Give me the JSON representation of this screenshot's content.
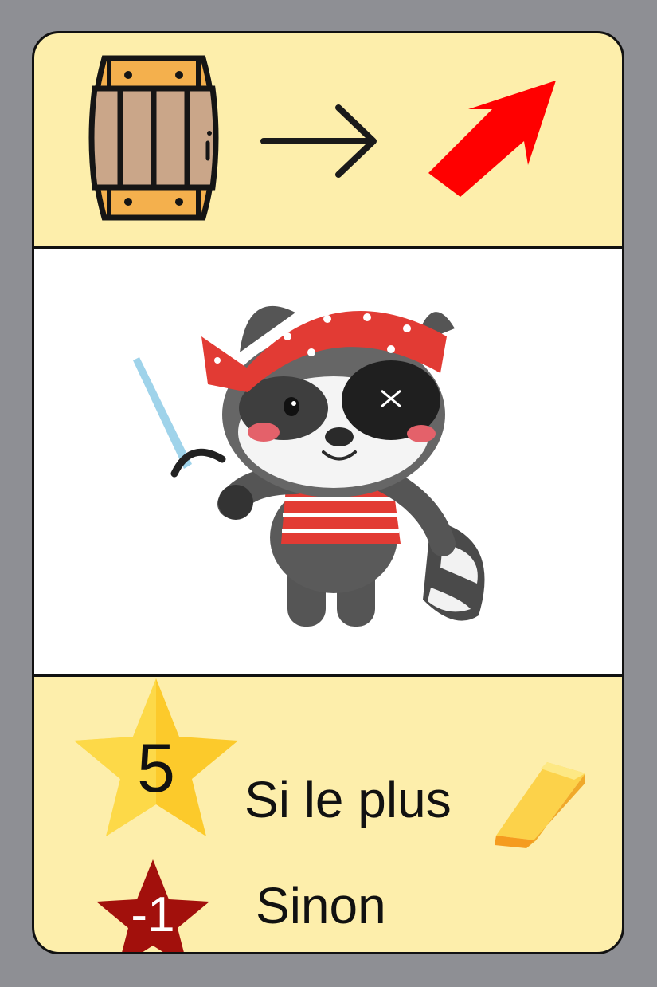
{
  "header": {
    "source_icon": "barrel-icon",
    "connector_icon": "right-arrow-icon",
    "result_icon": "red-up-right-arrow-icon"
  },
  "illustration": {
    "subject_icon": "pirate-raccoon-illustration"
  },
  "scoring": {
    "win": {
      "points": "5",
      "condition": "Si le plus",
      "badge_icon": "gold-star-icon",
      "resource_icon": "gold-bar-icon"
    },
    "lose": {
      "points": "-1",
      "condition": "Sinon",
      "badge_icon": "red-star-icon"
    }
  },
  "colors": {
    "card_bg": "#fdeeab",
    "page_bg": "#8e8f94",
    "star_gold": "#fcca2b",
    "star_red": "#a2100c",
    "arrow_red": "#ff0000"
  }
}
